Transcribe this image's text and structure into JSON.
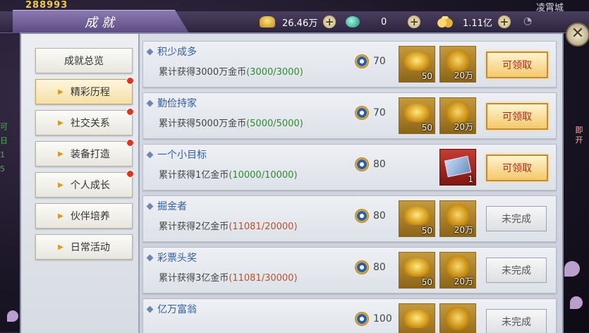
{
  "background": {
    "score_text": "288993",
    "city_text": "凌霄城",
    "left_chars": [
      "可",
      "日",
      "1",
      "5"
    ],
    "right_chars": [
      "即",
      "开"
    ]
  },
  "window": {
    "title": "成就",
    "close_label": "✕"
  },
  "currencies": [
    {
      "icon": "gold-ingot-icon",
      "value": "26.46万"
    },
    {
      "icon": "jade-icon",
      "value": "0"
    },
    {
      "icon": "coins-icon",
      "value": "1.11亿"
    }
  ],
  "sidebar": {
    "items": [
      {
        "label": "成就总览",
        "active": false,
        "dot": false,
        "arrow": false
      },
      {
        "label": "精彩历程",
        "active": true,
        "dot": true,
        "arrow": true
      },
      {
        "label": "社交关系",
        "active": false,
        "dot": true,
        "arrow": true
      },
      {
        "label": "装备打造",
        "active": false,
        "dot": true,
        "arrow": true
      },
      {
        "label": "个人成长",
        "active": false,
        "dot": true,
        "arrow": true
      },
      {
        "label": "伙伴培养",
        "active": false,
        "dot": false,
        "arrow": true
      },
      {
        "label": "日常活动",
        "active": false,
        "dot": false,
        "arrow": true
      }
    ]
  },
  "achievements": [
    {
      "title": "积少成多",
      "desc": "累计获得3000万金币",
      "progress": "(3000/3000)",
      "done": true,
      "points": "70",
      "rewards": [
        {
          "type": "gold",
          "qty": "50"
        },
        {
          "type": "bag",
          "qty": "20万"
        }
      ],
      "button": "可领取"
    },
    {
      "title": "勤俭持家",
      "desc": "累计获得5000万金币",
      "progress": "(5000/5000)",
      "done": true,
      "points": "70",
      "rewards": [
        {
          "type": "gold",
          "qty": "50"
        },
        {
          "type": "bag",
          "qty": "20万"
        }
      ],
      "button": "可领取"
    },
    {
      "title": "一个小目标",
      "desc": "累计获得1亿金币",
      "progress": "(10000/10000)",
      "done": true,
      "points": "80",
      "rewards": [
        {
          "type": "ticket",
          "qty": "1"
        }
      ],
      "button": "可领取"
    },
    {
      "title": "掘金者",
      "desc": "累计获得2亿金币",
      "progress": "(11081/20000)",
      "done": false,
      "points": "80",
      "rewards": [
        {
          "type": "gold",
          "qty": "50"
        },
        {
          "type": "bag",
          "qty": "20万"
        }
      ],
      "button": "未完成"
    },
    {
      "title": "彩票头奖",
      "desc": "累计获得3亿金币",
      "progress": "(11081/30000)",
      "done": false,
      "points": "80",
      "rewards": [
        {
          "type": "gold",
          "qty": "50"
        },
        {
          "type": "bag",
          "qty": "20万"
        }
      ],
      "button": "未完成"
    },
    {
      "title": "亿万富翁",
      "desc": "",
      "progress": "",
      "done": false,
      "points": "100",
      "rewards": [
        {
          "type": "gold",
          "qty": ""
        },
        {
          "type": "bag",
          "qty": ""
        }
      ],
      "button": "未完成"
    }
  ]
}
